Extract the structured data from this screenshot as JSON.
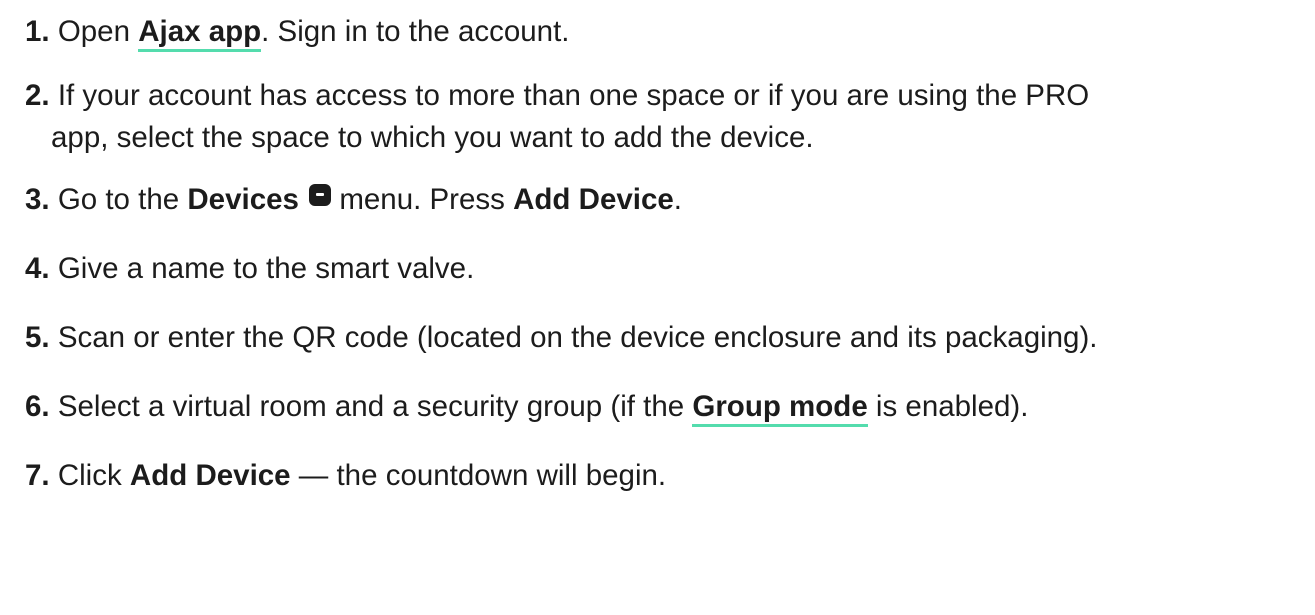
{
  "steps": [
    {
      "number": "1.",
      "text_before": "Open ",
      "link": "Ajax app",
      "text_after": ". Sign in to the account."
    },
    {
      "number": "2.",
      "line1": "If your account has access to more than one space or if you are using the PRO",
      "line2": "app, select the space to which you want to add the device."
    },
    {
      "number": "3.",
      "text_before": "Go to the ",
      "bold1": "Devices",
      "text_middle": " menu. Press ",
      "bold2": "Add Device",
      "text_after": "."
    },
    {
      "number": "4.",
      "text": "Give a name to the smart valve."
    },
    {
      "number": "5.",
      "text": "Scan or enter the QR code (located on the device enclosure and its packaging)."
    },
    {
      "number": "6.",
      "text_before": "Select a virtual room and a security group (if the ",
      "link": "Group mode",
      "text_after": " is enabled)."
    },
    {
      "number": "7.",
      "text_before": "Click ",
      "bold": "Add Device",
      "text_after": " — the countdown will begin."
    }
  ],
  "icons": {
    "devices": "devices-icon"
  },
  "colors": {
    "text": "#1c1c1c",
    "link_underline": "#54dcad"
  }
}
